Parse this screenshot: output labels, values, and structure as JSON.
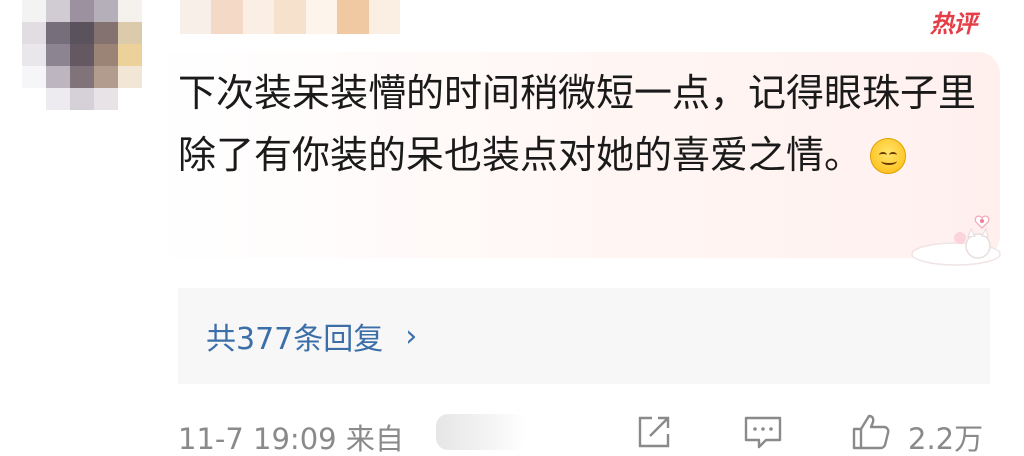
{
  "comment": {
    "hot_label": "热评",
    "text": "下次装呆装懵的时间稍微短一点，记得眼珠子里除了有你装的呆也装点对她的喜爱之情。",
    "emoji": "smile-emoji"
  },
  "replies": {
    "label": "共377条回复",
    "chevron": "›"
  },
  "footer": {
    "meta": "11-7 19:09 来自",
    "like_count": "2.2万"
  },
  "colors": {
    "hot": "#e53e47",
    "link": "#3c6fa8",
    "meta": "#8a8a8a"
  },
  "icons": [
    "share-icon",
    "comment-icon",
    "like-icon",
    "smile-emoji",
    "cat-decoration"
  ]
}
